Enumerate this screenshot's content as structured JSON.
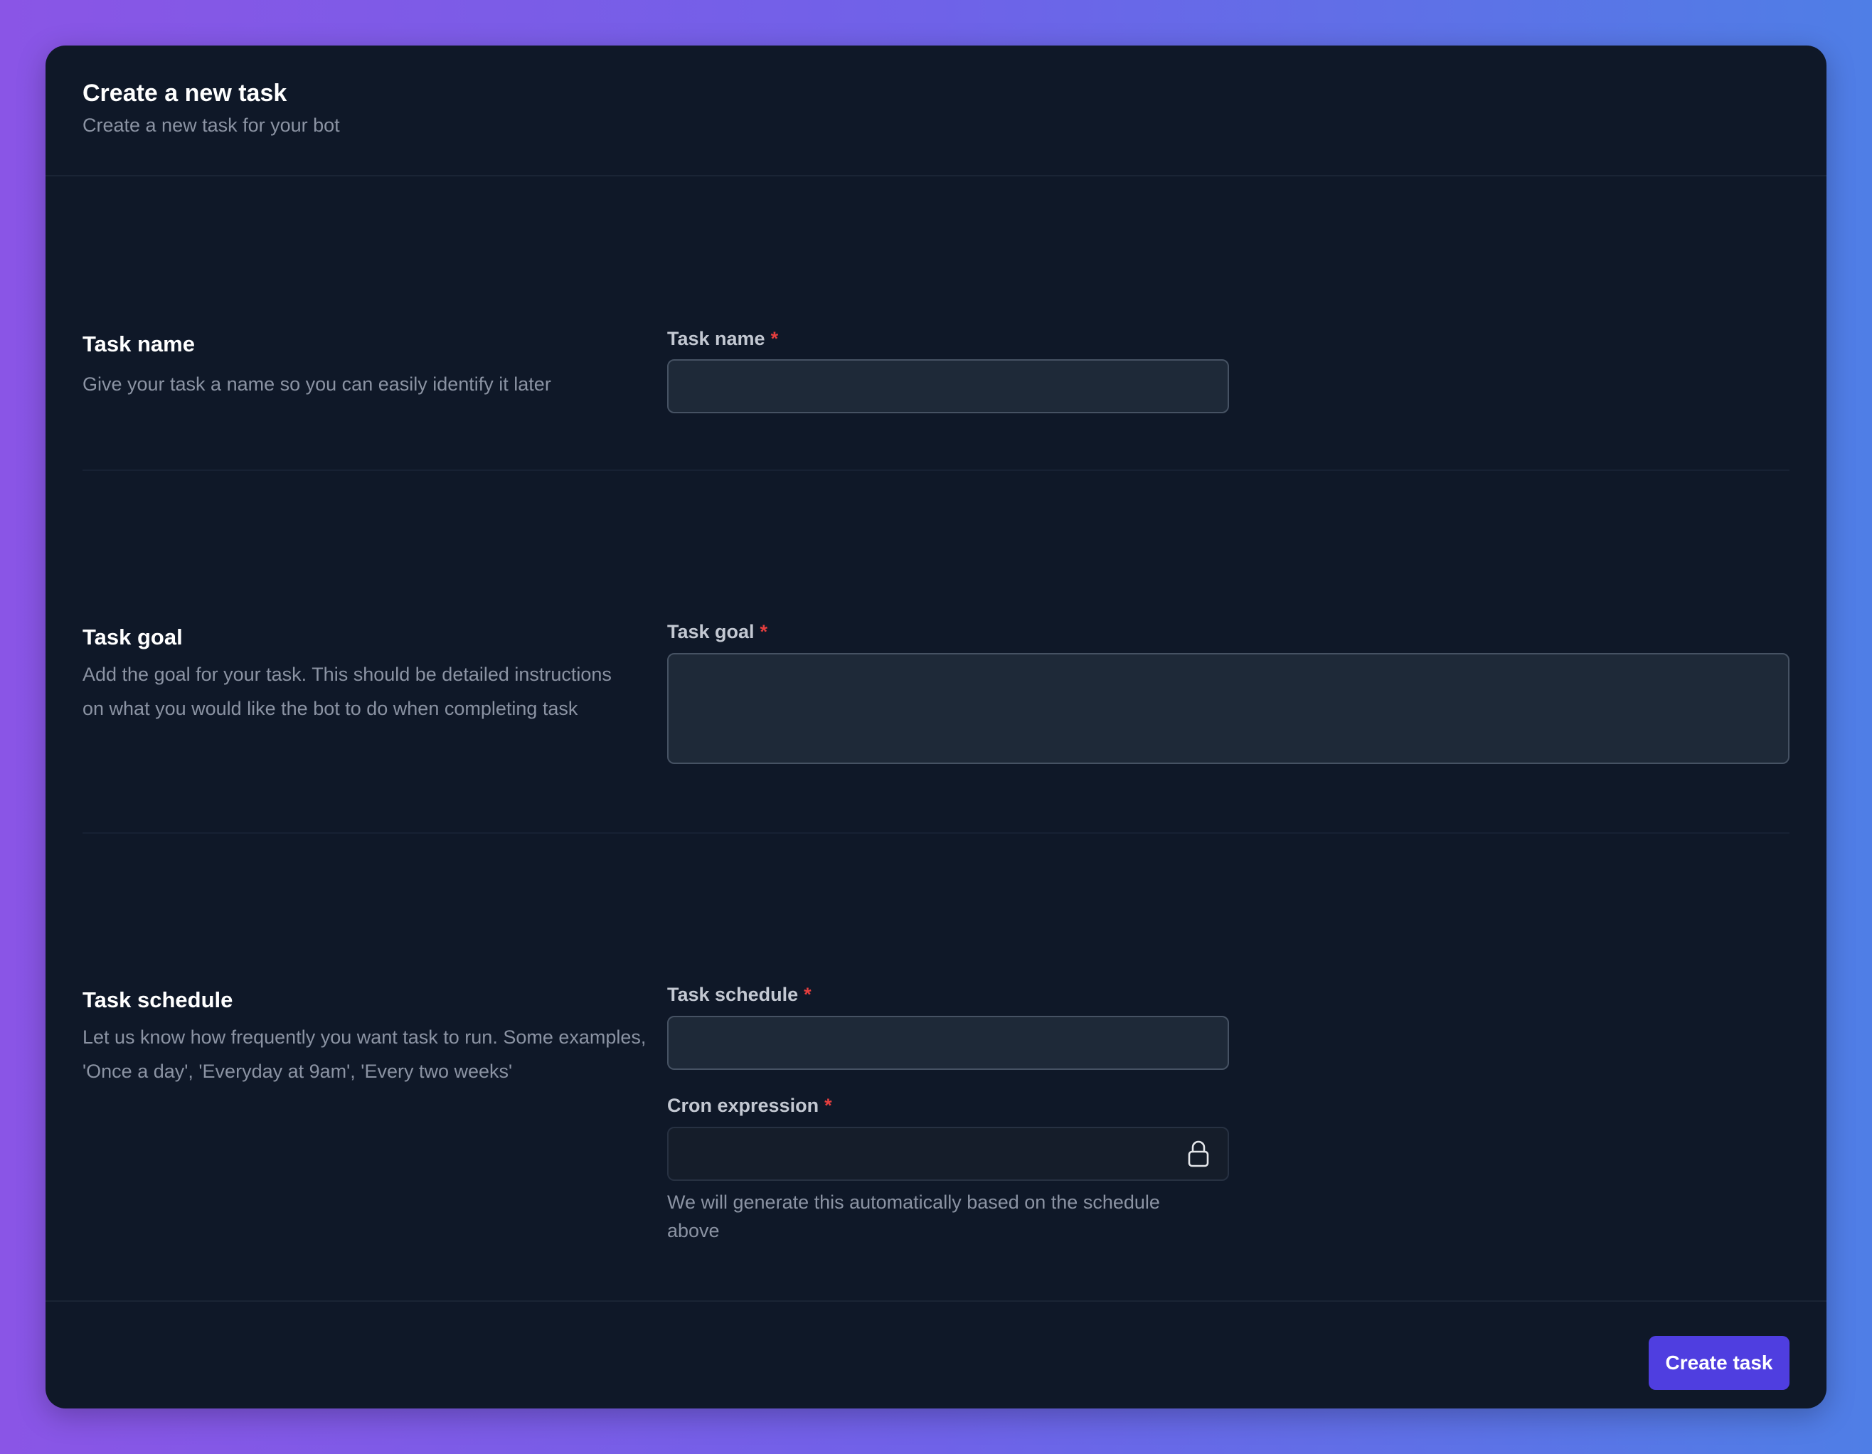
{
  "header": {
    "title": "Create a new task",
    "subtitle": "Create a new task for your bot"
  },
  "sections": {
    "name": {
      "title": "Task name",
      "description": "Give your task a name so you can easily identify it later",
      "field_label": "Task name",
      "required_mark": "*",
      "value": ""
    },
    "goal": {
      "title": "Task goal",
      "description": "Add the goal for your task. This should be detailed instructions on what you would like the bot to do when completing task",
      "field_label": "Task goal",
      "required_mark": "*",
      "value": ""
    },
    "schedule": {
      "title": "Task schedule",
      "description": "Let us know how frequently you want task to run. Some examples, 'Once a day', 'Everyday at 9am', 'Every two weeks'",
      "field_label": "Task schedule",
      "required_mark": "*",
      "value": "",
      "cron_label": "Cron expression",
      "cron_required_mark": "*",
      "cron_value": "",
      "cron_icon": "lock-icon",
      "cron_help": "We will generate this automatically based on the schedule above"
    }
  },
  "footer": {
    "submit_label": "Create task"
  },
  "colors": {
    "primary": "#4f3ee0",
    "required": "#e53e3e",
    "card_bg": "#0f1828"
  }
}
